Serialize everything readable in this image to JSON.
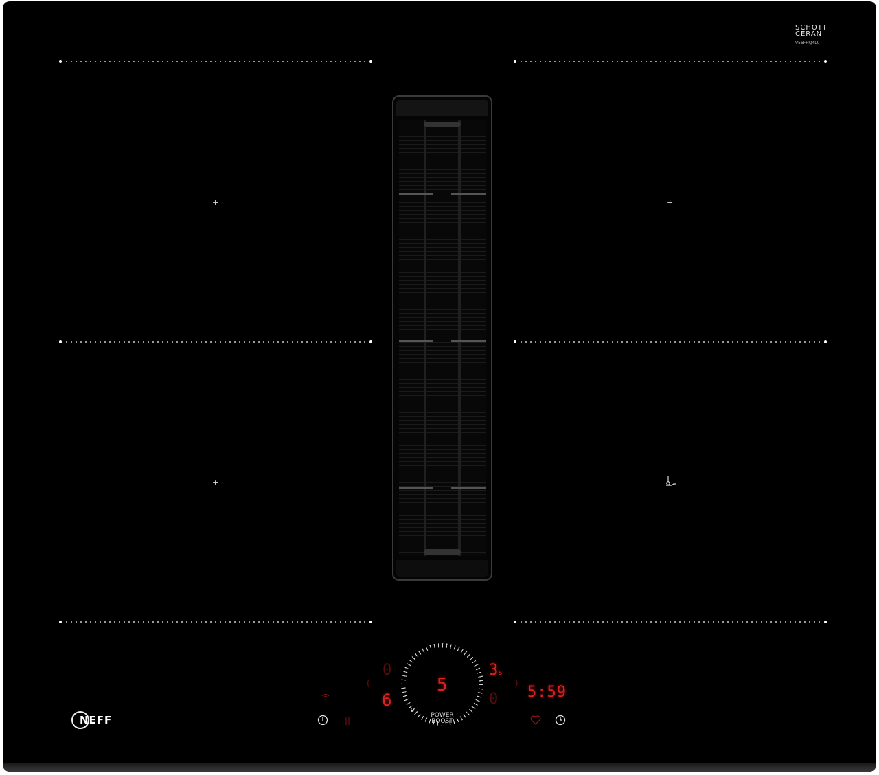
{
  "brand": {
    "logo_text": "NEFF",
    "glass_brand_line1": "SCHOTT",
    "glass_brand_line2": "CERAN",
    "model_code": "V56FHQ4L0"
  },
  "display": {
    "fan_level": "5",
    "left_top_digit": "0",
    "left_bottom_digit": "6",
    "right_top_digit": "3",
    "right_top_suffix": "s",
    "right_bottom_digit": "0",
    "timer_value": "5:59",
    "dial_zero": "0",
    "power_boost_line1": "POWER",
    "power_boost_line2": "BOOST"
  },
  "icons": {
    "power": "power-icon",
    "heart": "favourite-icon",
    "clock": "timer-clock-icon",
    "frying_sensor": "frying-sensor-icon",
    "wifi": "home-connect-icon"
  },
  "colors": {
    "glass": "#000000",
    "display_red": "#e0201c",
    "markings": "#ffffff"
  }
}
